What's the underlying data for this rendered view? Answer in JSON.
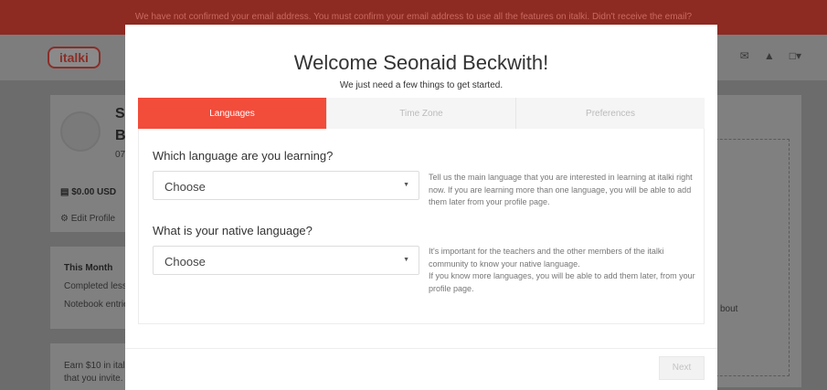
{
  "banner": {
    "text": "We have not confirmed your email address. You must confirm your email address to use all the features on italki. Didn't receive the email?"
  },
  "header": {
    "logo_text": "italki",
    "mail_icon": "mail-icon",
    "bell_icon": "bell-icon",
    "avatar_icon": "avatar-icon"
  },
  "background_profile": {
    "name_initial_1": "S",
    "name_initial_2": "B",
    "id_fragment": "07",
    "balance": "$0.00 USD",
    "edit_profile": "Edit Profile",
    "this_month": "This Month",
    "completed_lessons": "Completed less",
    "notebook_entries": "Notebook entrie",
    "earn_line1": "Earn $10 in itali",
    "earn_line2": "that you invite.",
    "right_fragment": "bout"
  },
  "modal": {
    "title": "Welcome Seonaid Beckwith!",
    "subtitle": "We just need a few things to get started.",
    "tabs": [
      {
        "label": "Languages",
        "active": true
      },
      {
        "label": "Time Zone",
        "active": false
      },
      {
        "label": "Preferences",
        "active": false
      }
    ],
    "learning": {
      "question": "Which language are you learning?",
      "value": "Choose",
      "hint": "Tell us the main language that you are interested in learning at italki right now. If you are learning more than one language, you will be able to add them later from your profile page."
    },
    "native": {
      "question": "What is your native language?",
      "value": "Choose",
      "hint_1": "It's important for the teachers and the other members of the italki community to know your native language.",
      "hint_2": "If you know more languages, you will be able to add them later, from your profile page."
    },
    "next_label": "Next"
  },
  "colors": {
    "accent": "#f24c3b",
    "overlay_banner": "#8d2a22"
  }
}
